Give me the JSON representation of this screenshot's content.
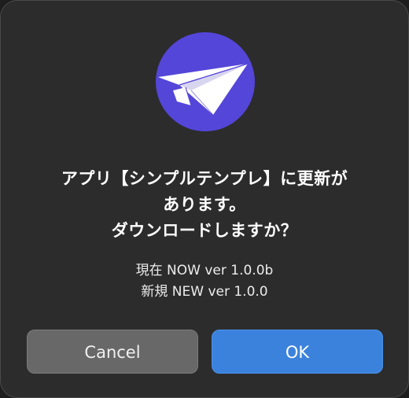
{
  "dialog": {
    "icon": "paper-plane-icon",
    "icon_background": "#5446d8",
    "message_lines": [
      "アプリ【シンプルテンプレ】に更新が",
      "あります。",
      "ダウンロードしますか？"
    ],
    "current_version": "現在 NOW ver 1.0.0b",
    "new_version": "新規 NEW ver 1.0.0"
  },
  "buttons": {
    "cancel_label": "Cancel",
    "ok_label": "OK",
    "ok_color": "#3b82dc",
    "cancel_color": "#686868"
  }
}
